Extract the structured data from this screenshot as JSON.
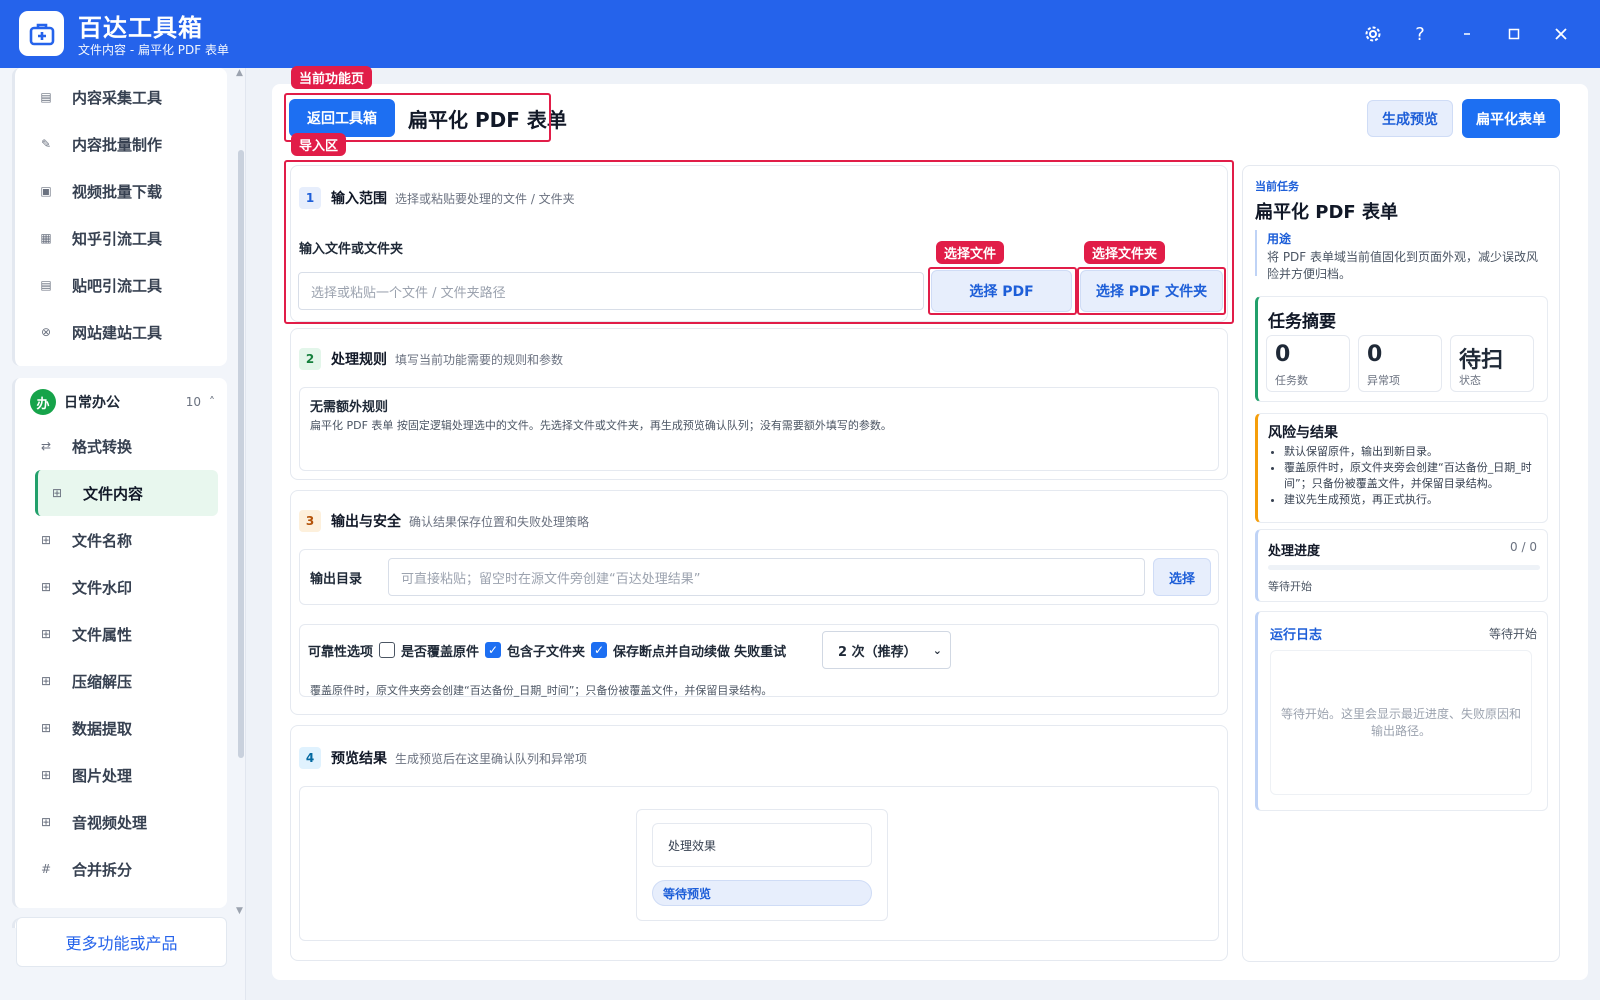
{
  "app": {
    "title": "百达工具箱",
    "subtitle": "文件内容 - 扁平化 PDF 表单"
  },
  "window_controls": [
    "gear-icon",
    "help-icon",
    "minimize-icon",
    "maximize-icon",
    "close-icon"
  ],
  "sidebar": {
    "top_items": [
      {
        "label": "内容采集工具",
        "icon": "collect-icon"
      },
      {
        "label": "内容批量制作",
        "icon": "pen-icon"
      },
      {
        "label": "视频批量下载",
        "icon": "video-icon"
      },
      {
        "label": "知乎引流工具",
        "icon": "zhihu-icon"
      },
      {
        "label": "贴吧引流工具",
        "icon": "tieba-icon"
      },
      {
        "label": "网站建站工具",
        "icon": "web-icon"
      }
    ],
    "group": {
      "avatar": "办",
      "name": "日常办公",
      "count": "10",
      "caret": "˄"
    },
    "group_items": [
      {
        "label": "格式转换",
        "icon": "convert-icon"
      },
      {
        "label": "文件内容",
        "icon": "grid-icon"
      },
      {
        "label": "文件名称",
        "icon": "grid-icon"
      },
      {
        "label": "文件水印",
        "icon": "grid-icon"
      },
      {
        "label": "文件属性",
        "icon": "grid-icon"
      },
      {
        "label": "压缩解压",
        "icon": "grid-icon"
      },
      {
        "label": "数据提取",
        "icon": "grid-icon"
      },
      {
        "label": "图片处理",
        "icon": "grid-icon"
      },
      {
        "label": "音视频处理",
        "icon": "grid-icon"
      },
      {
        "label": "合并拆分",
        "icon": "hash-icon"
      }
    ],
    "active": "文件内容",
    "more_button": "更多功能或产品"
  },
  "header": {
    "back_button": "返回工具箱",
    "page_title": "扁平化 PDF 表单",
    "preview_button": "生成预览",
    "run_button": "扁平化表单"
  },
  "annotations": {
    "current_page": "当前功能页",
    "import_area": "导入区",
    "select_file": "选择文件",
    "select_folder": "选择文件夹"
  },
  "section1": {
    "num": "1",
    "title": "输入范围",
    "desc": "选择或粘贴要处理的文件 / 文件夹",
    "field_label": "输入文件或文件夹",
    "input_placeholder": "选择或粘贴一个文件 / 文件夹路径",
    "select_pdf": "选择 PDF",
    "select_pdf_folder": "选择 PDF 文件夹"
  },
  "section2": {
    "num": "2",
    "title": "处理规则",
    "desc": "填写当前功能需要的规则和参数",
    "rule_title": "无需额外规则",
    "rule_text": "扁平化 PDF 表单 按固定逻辑处理选中的文件。先选择文件或文件夹，再生成预览确认队列；没有需要额外填写的参数。"
  },
  "section3": {
    "num": "3",
    "title": "输出与安全",
    "desc": "确认结果保存位置和失败处理策略",
    "output_label": "输出目录",
    "output_placeholder": "可直接粘贴；留空时在源文件旁创建“百达处理结果”",
    "output_select": "选择",
    "reliability_label": "可靠性选项",
    "options": [
      {
        "label": "是否覆盖原件",
        "checked": false
      },
      {
        "label": "包含子文件夹",
        "checked": true
      },
      {
        "label": "保存断点并自动续做",
        "checked": true
      }
    ],
    "retry_label": "失败重试",
    "retry_value": "2 次（推荐）",
    "note": "覆盖原件时，原文件夹旁会创建“百达备份_日期_时间”；只备份被覆盖文件，并保留目录结构。"
  },
  "section4": {
    "num": "4",
    "title": "预览结果",
    "desc": "生成预览后在这里确认队列和异常项",
    "effect_label": "处理效果",
    "status_pill": "等待预览"
  },
  "right_panel": {
    "current_task_label": "当前任务",
    "task_title": "扁平化 PDF 表单",
    "usage_label": "用途",
    "usage_text": "将 PDF 表单域当前值固化到页面外观，减少误改风险并方便归档。",
    "summary_title": "任务摘要",
    "stats": [
      {
        "value": "0",
        "label": "任务数"
      },
      {
        "value": "0",
        "label": "异常项"
      },
      {
        "value": "待扫",
        "label": "状态"
      }
    ],
    "risk_title": "风险与结果",
    "risk_items": [
      "默认保留原件，输出到新目录。",
      "覆盖原件时，原文件夹旁会创建“百达备份_日期_时间”；只备份被覆盖文件，并保留目录结构。",
      "建议先生成预览，再正式执行。"
    ],
    "progress_title": "处理进度",
    "progress_count": "0 / 0",
    "progress_value": 0,
    "progress_status": "等待开始",
    "log_title": "运行日志",
    "log_status": "等待开始",
    "log_placeholder": "等待开始。这里会显示最近进度、失败原因和输出路径。"
  },
  "colors": {
    "brand": "#2563eb",
    "primary_button": "#1d6ff2",
    "annotation_red": "#e11d48",
    "active_green": "#22a06b",
    "risk_orange": "#f59e0b"
  }
}
